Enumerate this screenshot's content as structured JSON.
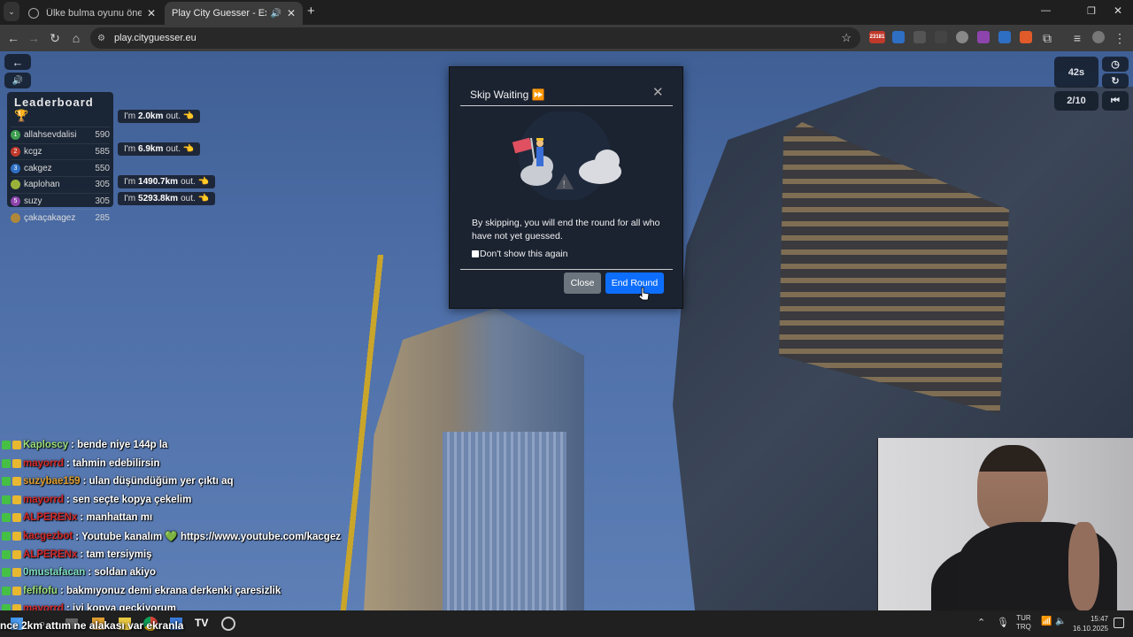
{
  "browser": {
    "tabs": [
      {
        "title": "Ülke bulma oyunu önerileri",
        "active": false
      },
      {
        "title": "Play City Guesser - Explore",
        "active": true
      }
    ],
    "new_tab_symbol": "+",
    "url": "play.cityguesser.eu",
    "window_controls": [
      "—",
      "❐",
      "✕"
    ],
    "ext_badge": "23181",
    "icons": [
      "back-icon",
      "forward-icon",
      "reload-icon",
      "home-icon",
      "site-info-icon",
      "star-icon",
      "extensions-icon",
      "menu-icon"
    ]
  },
  "game": {
    "back_symbol": "←",
    "sound_symbol": "🔊",
    "timer": "42s",
    "round": "2/10",
    "leaderboard_title": "Leaderboard",
    "leaderboard": [
      {
        "rank": "1",
        "name": "allahsevdalisi",
        "score": "590",
        "color": "#3f9f4f"
      },
      {
        "rank": "2",
        "name": "kcgz",
        "score": "585",
        "color": "#c0392b"
      },
      {
        "rank": "3",
        "name": "cakgez",
        "score": "550",
        "color": "#2e6fc4"
      },
      {
        "rank": "",
        "name": "kaplohan",
        "score": "305",
        "color": "#9ab23a"
      },
      {
        "rank": "5",
        "name": "suzy",
        "score": "305",
        "color": "#8e44ad"
      },
      {
        "rank": "",
        "name": "çakaçakagez",
        "score": "285",
        "color": "#b0883a"
      }
    ],
    "bubbles": [
      {
        "prefix": "I'm",
        "dist": "2.0km",
        "suffix": "out."
      },
      {
        "prefix": "I'm",
        "dist": "6.9km",
        "suffix": "out."
      },
      {
        "prefix": "I'm",
        "dist": "1490.7km",
        "suffix": "out."
      },
      {
        "prefix": "I'm",
        "dist": "5293.8km",
        "suffix": "out."
      }
    ]
  },
  "modal": {
    "title": "Skip Waiting ⏩",
    "close_symbol": "✕",
    "message": "By skipping, you will end the round for all who have not yet guessed.",
    "checkbox_label": "Don't show this again",
    "close_label": "Close",
    "end_label": "End Round"
  },
  "chat": [
    {
      "user": "Kaploscy",
      "color": "#9be07a",
      "msg": ": bende niye 144p la"
    },
    {
      "user": "mayorrd",
      "color": "#d42a2a",
      "msg": ": tahmin edebilirsin"
    },
    {
      "user": "suzybae159",
      "color": "#e0a030",
      "msg": ": ulan düşündüğüm yer çıktı aq"
    },
    {
      "user": "mayorrd",
      "color": "#d42a2a",
      "msg": ": sen seçte kopya çekelim"
    },
    {
      "user": "ALPERENx",
      "color": "#d42a2a",
      "msg": ": manhattan mı"
    },
    {
      "user": "kacgezbot",
      "color": "#d42a2a",
      "msg": ": Youtube kanalım 💚 https://www.youtube.com/kacgez"
    },
    {
      "user": "ALPERENx",
      "color": "#d42a2a",
      "msg": ": tam tersiymiş"
    },
    {
      "user": "0mustafacan",
      "color": "#7fe0c0",
      "msg": ": soldan akiyo"
    },
    {
      "user": "fefifofu",
      "color": "#9be07a",
      "msg": ": bakmıyonuz demi ekrana derkenki çaresizlik"
    },
    {
      "user": "mayorrd",
      "color": "#d42a2a",
      "msg": ": iyi kopya geçkiyorum"
    }
  ],
  "subtitle": "nce 2km attım ne alakası var ekranla",
  "taskbar": {
    "lang_top": "TUR",
    "lang_bottom": "TRQ",
    "time": "15:47",
    "date": "16.10.2025"
  }
}
